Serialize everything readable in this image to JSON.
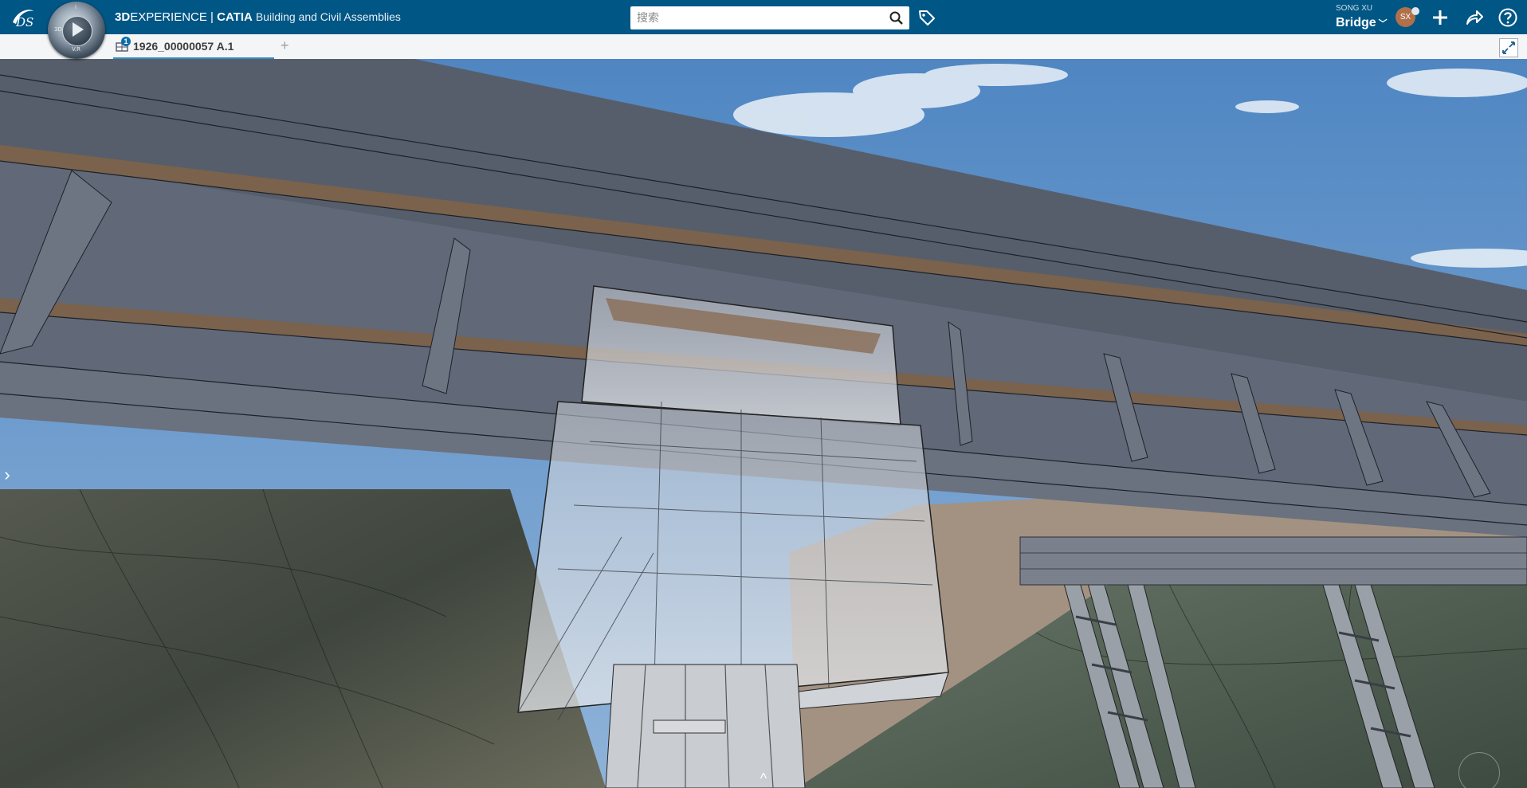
{
  "header": {
    "brand": "3D",
    "product": "EXPERIENCE",
    "separator": " | ",
    "app": "CATIA",
    "app_subtitle": "Building and Civil Assemblies",
    "compass_labels": {
      "left": "3D",
      "bottom": "V.R",
      "top": "i"
    },
    "search_placeholder": "搜索",
    "user_name": "SONG XU",
    "workspace": "Bridge",
    "avatar_initials": "SX"
  },
  "tabs": [
    {
      "label": "1926_00000057 A.1",
      "badge": "1",
      "active": true
    }
  ],
  "tab_add_label": "+",
  "viewport": {
    "left_handle": "›",
    "bottom_handle": "^"
  },
  "colors": {
    "topbar": "#005685",
    "tab_accent": "#368ec4",
    "sky": "#5e8fc4",
    "structure": "#5b6270",
    "wood_band": "#7a624c"
  },
  "icons": [
    "ds-logo-icon",
    "compass-icon",
    "search-icon",
    "tag-icon",
    "add-icon",
    "share-icon",
    "help-icon",
    "fullscreen-icon",
    "model-icon"
  ]
}
